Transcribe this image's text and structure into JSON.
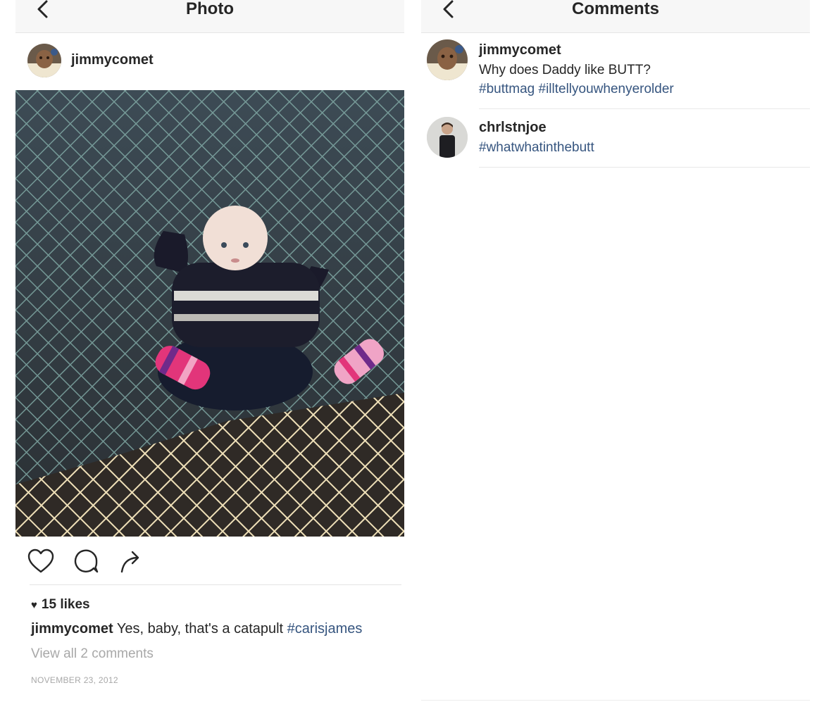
{
  "photo_screen": {
    "title": "Photo",
    "post": {
      "username": "jimmycomet",
      "likes": "15 likes",
      "caption_user": "jimmycomet",
      "caption_text": " Yes, baby, that's a catapult ",
      "caption_hashtag": "#carisjames",
      "view_all_comments": "View all 2 comments",
      "date": "NOVEMBER 23, 2012"
    },
    "icons": [
      "chevron-left-icon",
      "heart-icon",
      "comment-icon",
      "share-icon"
    ]
  },
  "comments_screen": {
    "title": "Comments",
    "comments": [
      {
        "username": "jimmycomet",
        "text": "Why does Daddy like BUTT?",
        "hashtags": "#buttmag #illtellyouwhenyerolder"
      },
      {
        "username": "chrlstnjoe",
        "text": "",
        "hashtags": "#whatwhatinthebutt"
      }
    ]
  },
  "colors": {
    "text": "#262626",
    "hashtag": "#36557f",
    "muted": "#a8a8a8",
    "header_bg": "#f7f7f7"
  }
}
